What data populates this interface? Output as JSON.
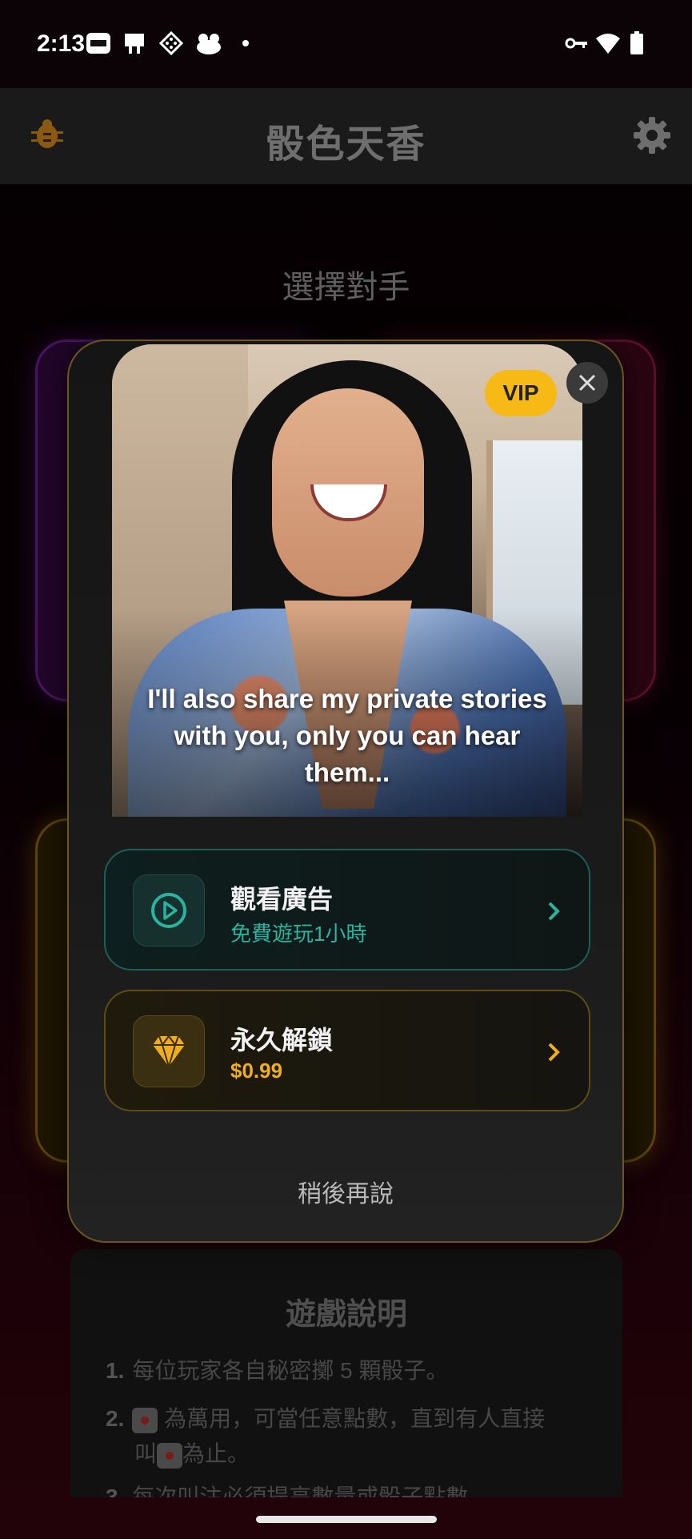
{
  "status_bar": {
    "time": "2:13",
    "icons": [
      "notification-app-icon",
      "notification-book-icon",
      "notification-game-icon",
      "notification-toy-icon",
      "dot-icon",
      "vpn-key-icon",
      "wifi-icon",
      "battery-icon"
    ]
  },
  "app_bar": {
    "title": "骰色天香",
    "left_icon": "bug-icon",
    "right_icon": "gear-icon"
  },
  "main": {
    "section_title": "選擇對手"
  },
  "rules": {
    "title": "遊戲說明",
    "items": [
      {
        "num": "1.",
        "text": "每位玩家各自秘密擲 5 顆骰子。"
      },
      {
        "num": "2.",
        "text_a": "為萬用，可當任意點數，直到有人直接",
        "text_b": "叫",
        "text_c": "為止。"
      },
      {
        "num": "3.",
        "text": "每次叫注必須提高數量或骰子點數"
      }
    ]
  },
  "modal": {
    "badge": "VIP",
    "caption": "I'll also share my private stories with you, only you can hear them...",
    "options": [
      {
        "label": "觀看廣告",
        "sub": "免費遊玩1小時",
        "icon": "play-circle-icon",
        "accent": "#2bb3a0"
      },
      {
        "label": "永久解鎖",
        "sub": "$0.99",
        "icon": "diamond-icon",
        "accent": "#f0ad1e"
      }
    ],
    "dismiss": "稍後再說"
  },
  "colors": {
    "vip": "#f7b916",
    "teal": "#2bb3a0",
    "gold": "#f0ad1e"
  }
}
